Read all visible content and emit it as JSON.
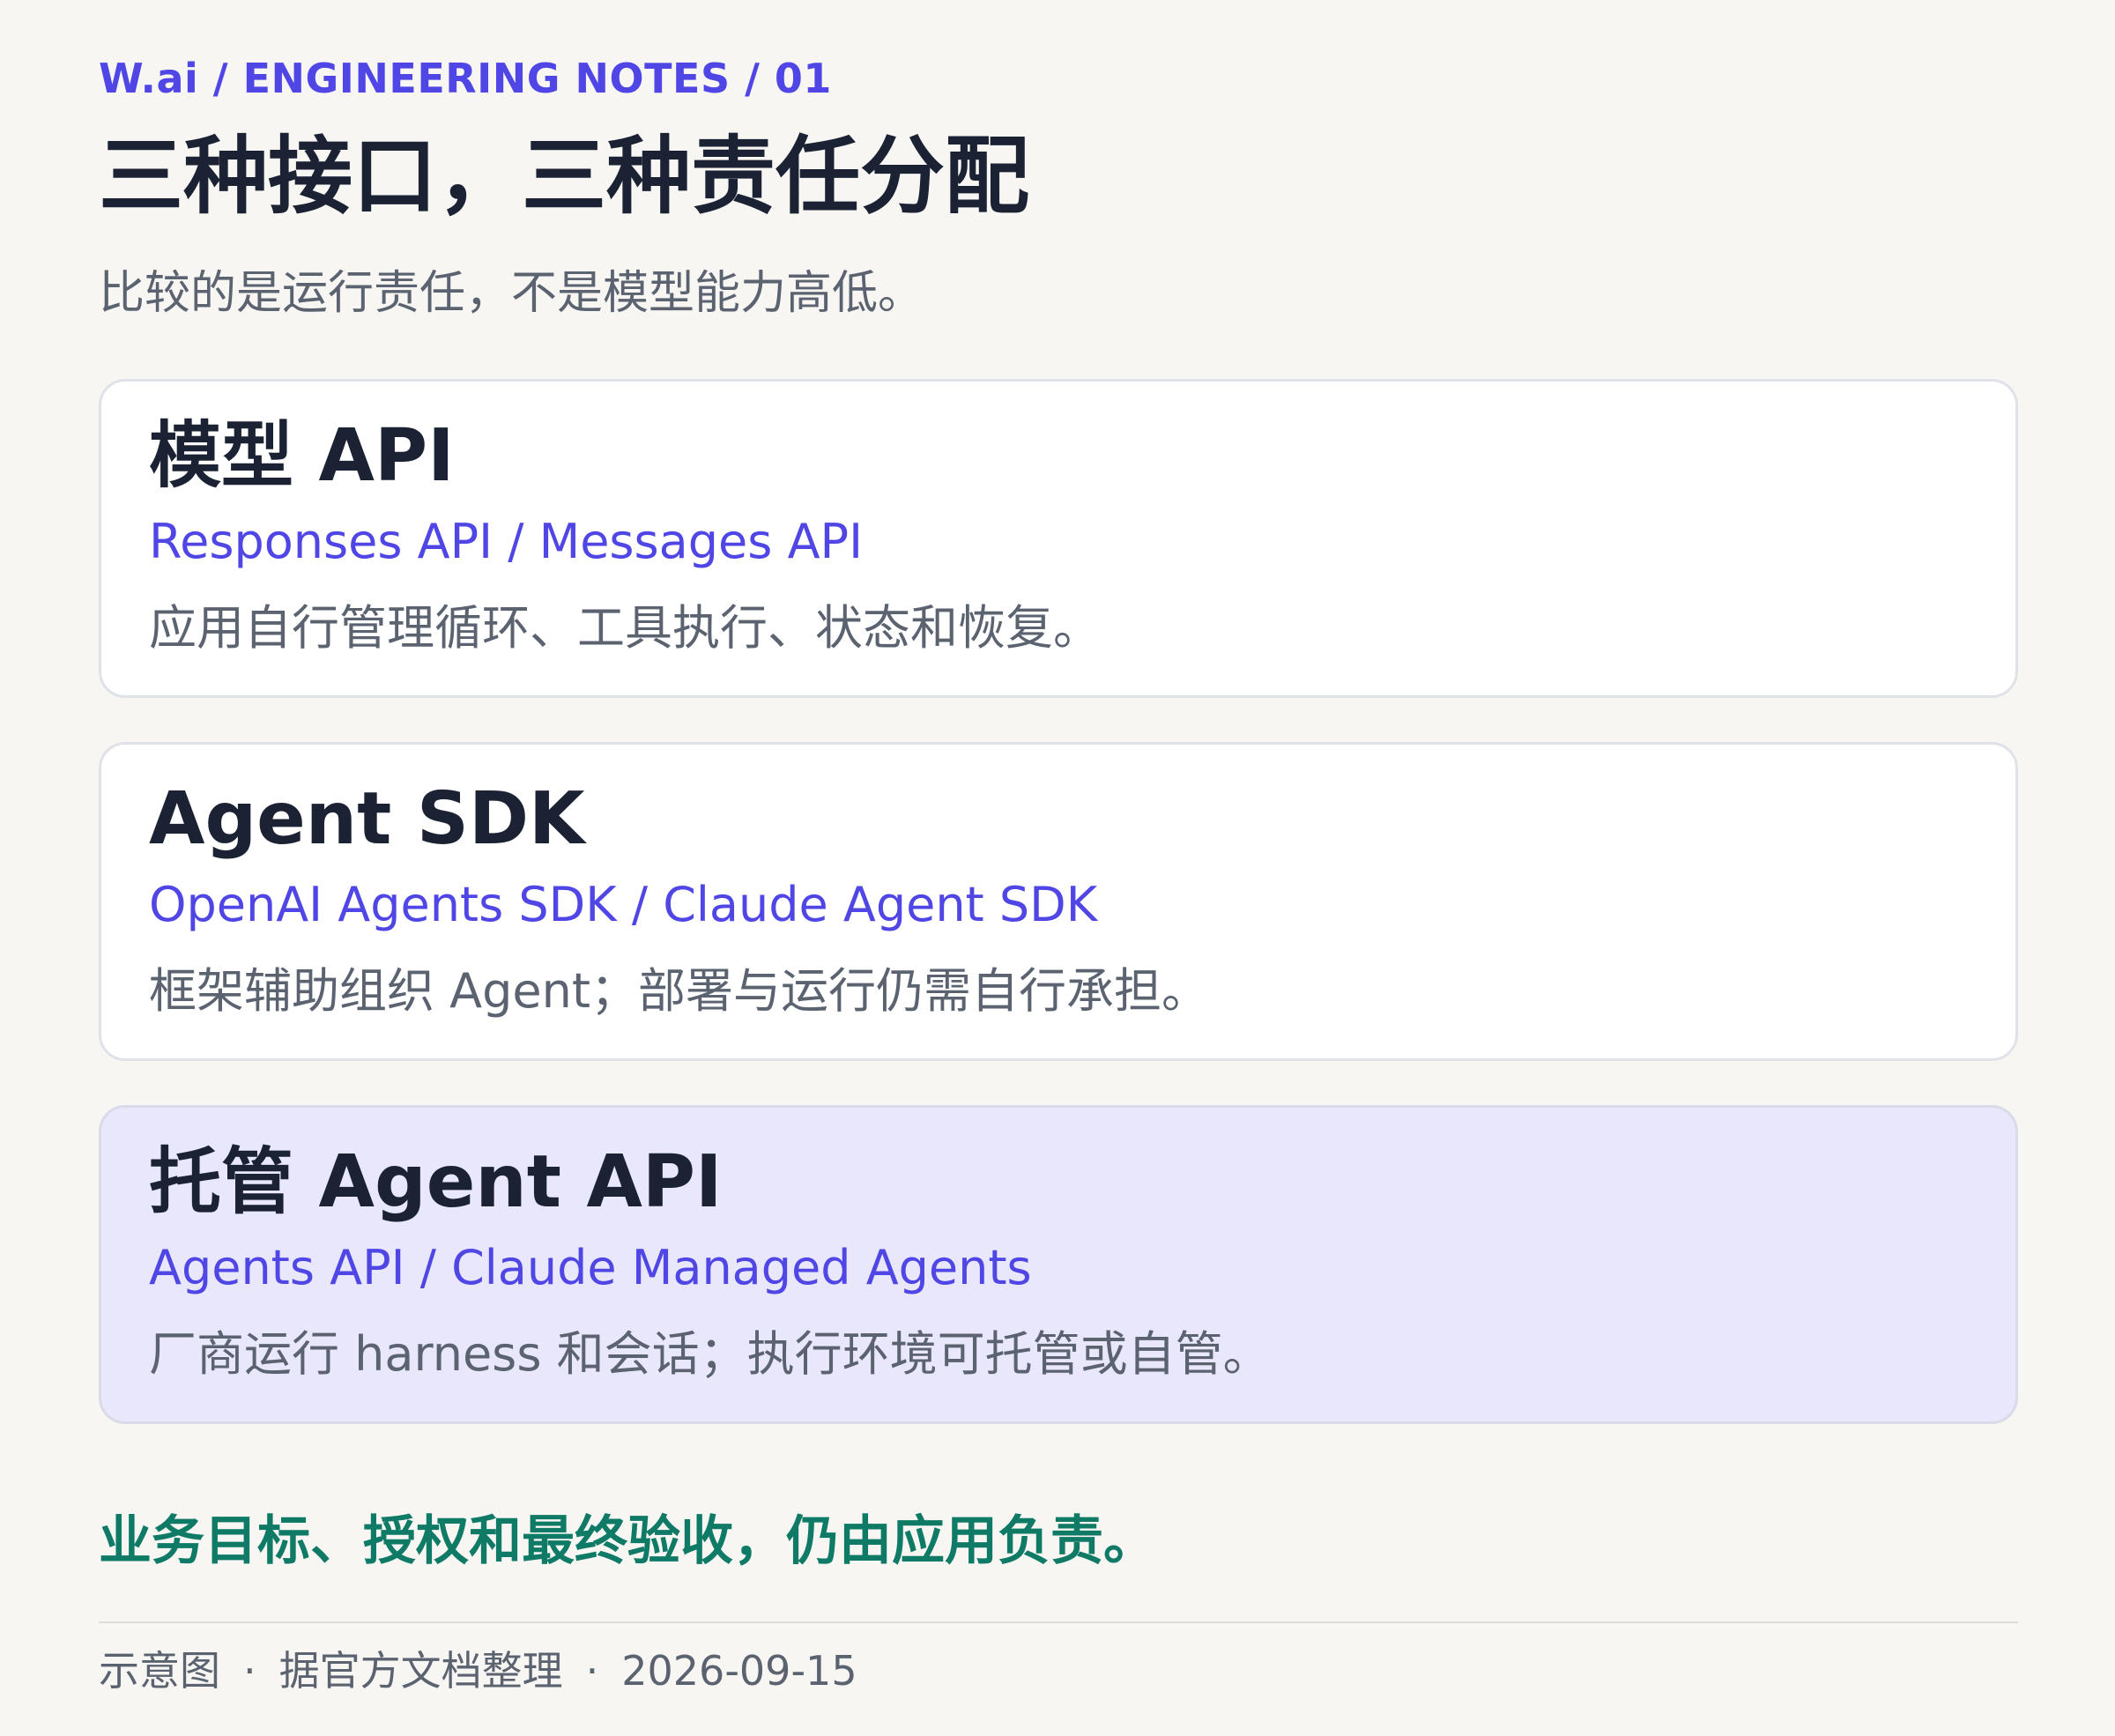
{
  "header": {
    "eyebrow": "W.ai / ENGINEERING NOTES / 01",
    "title": "三种接口，三种责任分配",
    "subtitle": "比较的是运行责任，不是模型能力高低。"
  },
  "cards": [
    {
      "title": "模型 API",
      "products": "Responses API / Messages API",
      "description": "应用自行管理循环、工具执行、状态和恢复。"
    },
    {
      "title": "Agent SDK",
      "products": "OpenAI Agents SDK / Claude Agent SDK",
      "description": "框架辅助组织 Agent；部署与运行仍需自行承担。"
    },
    {
      "title": "托管 Agent API",
      "products": "Agents API / Claude Managed Agents",
      "description": "厂商运行 harness 和会话；执行环境可托管或自管。"
    }
  ],
  "conclusion": "业务目标、授权和最终验收，仍由应用负责。",
  "footer": {
    "type": "示意图",
    "source": "据官方文档整理",
    "date": "2026-09-15",
    "separator": "·"
  },
  "colors": {
    "accent": "#4f46e5",
    "conclusion": "#0f7a66",
    "highlight_card_bg": "#e8e7fb",
    "background": "#f7f6f2"
  }
}
